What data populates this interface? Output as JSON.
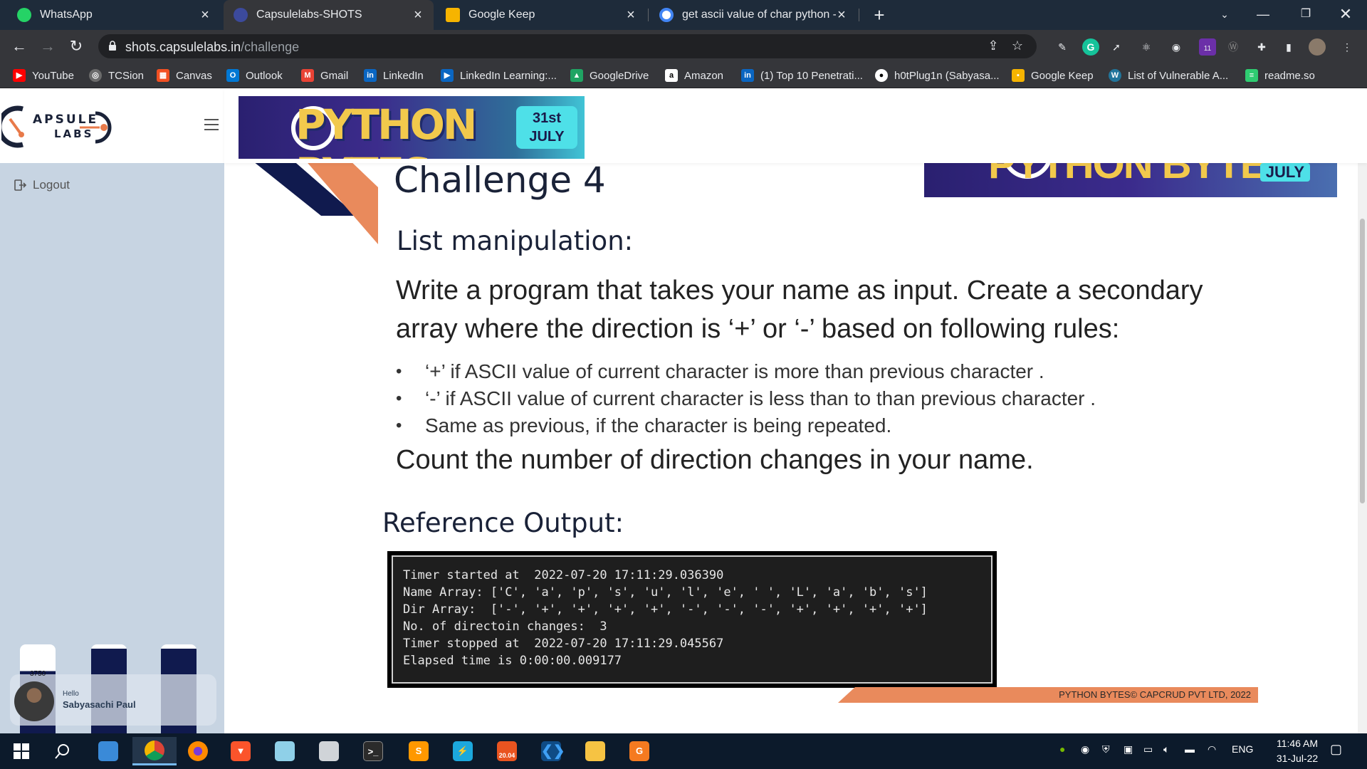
{
  "browser": {
    "tabs": [
      {
        "label": "WhatsApp",
        "color": "#25d366"
      },
      {
        "label": "Capsulelabs-SHOTS",
        "color": "#3c4a9c"
      },
      {
        "label": "Google Keep",
        "color": "#f6b400"
      },
      {
        "label": "get ascii value of char python - G",
        "color": "#ffffff"
      }
    ],
    "url_host": "shots.capsulelabs.in",
    "url_path": "/challenge",
    "bookmarks": [
      {
        "label": "YouTube",
        "icon": "youtube-icon",
        "color": "#ff0000",
        "glyph": "▶"
      },
      {
        "label": "TCSion",
        "icon": "tcsion-icon",
        "color": "#6b6b6b",
        "glyph": "◎"
      },
      {
        "label": "Canvas",
        "icon": "canvas-icon",
        "color": "#f25022",
        "glyph": "▦"
      },
      {
        "label": "Outlook",
        "icon": "outlook-icon",
        "color": "#0078d4",
        "glyph": "O"
      },
      {
        "label": "Gmail",
        "icon": "gmail-icon",
        "color": "#ea4335",
        "glyph": "M"
      },
      {
        "label": "LinkedIn",
        "icon": "linkedin-icon",
        "color": "#0a66c2",
        "glyph": "in"
      },
      {
        "label": "LinkedIn Learning:...",
        "icon": "linkedin-learning-icon",
        "color": "#0a66c2",
        "glyph": "▶"
      },
      {
        "label": "GoogleDrive",
        "icon": "google-drive-icon",
        "color": "#1fa463",
        "glyph": "▲"
      },
      {
        "label": "Amazon",
        "icon": "amazon-icon",
        "color": "#ffffff",
        "glyph": "a"
      },
      {
        "label": "(1) Top 10 Penetrati...",
        "icon": "linkedin-icon",
        "color": "#0a66c2",
        "glyph": "in"
      },
      {
        "label": "h0tPlug1n (Sabyasa...",
        "icon": "github-icon",
        "color": "#ffffff",
        "glyph": "●"
      },
      {
        "label": "Google Keep",
        "icon": "google-keep-icon",
        "color": "#f6b400",
        "glyph": "▪"
      },
      {
        "label": "List of Vulnerable A...",
        "icon": "wordpress-icon",
        "color": "#21759b",
        "glyph": "W"
      },
      {
        "label": "readme.so",
        "icon": "readme-icon",
        "color": "#2ecc71",
        "glyph": "≡"
      }
    ]
  },
  "sidebar": {
    "logo_top": "APSULE",
    "logo_bottom": "LABS",
    "logout_label": "Logout",
    "bar_label": "3750",
    "greeting": "Hello",
    "user_name": "Sabyasachi Paul"
  },
  "banner": {
    "title": "PYTHON BYTES",
    "date_day": "31st",
    "date_month": "JULY"
  },
  "slide": {
    "banner_month": "JULY",
    "title": "Challenge 4",
    "subtitle": "List manipulation:",
    "prose_line1": "Write a program that takes your name as input.  Create a secondary",
    "prose_line2": "array where the direction is ‘+’ or ‘-’ based on following rules:",
    "bullets": [
      "‘+’ if  ASCII value of current character is more than previous character .",
      "‘-’ if  ASCII value of current character is less than to  than previous character .",
      "Same as previous, if the character is being repeated."
    ],
    "count_line": "Count the number of direction  changes in your name.",
    "reference_label": "Reference Output:",
    "terminal_lines": [
      "Timer started at  2022-07-20 17:11:29.036390",
      "Name Array: ['C', 'a', 'p', 's', 'u', 'l', 'e', ' ', 'L', 'a', 'b', 's']",
      "Dir Array:  ['-', '+', '+', '+', '+', '-', '-', '-', '+', '+', '+', '+']",
      "No. of directoin changes:  3",
      "Timer stopped at  2022-07-20 17:11:29.045567",
      "Elapsed time is 0:00:00.009177"
    ],
    "footer": "PYTHON BYTES© CAPCRUD PVT LTD, 2022"
  },
  "taskbar": {
    "language": "ENG",
    "time": "11:46 AM",
    "date": "31-Jul-22",
    "badge": "11",
    "sublime_version": "20.04"
  },
  "colors": {
    "navy": "#1a2238",
    "orange": "#e98a5c",
    "sidebar_bg": "#c7d4e2",
    "bar_dark": "#101a4e"
  }
}
